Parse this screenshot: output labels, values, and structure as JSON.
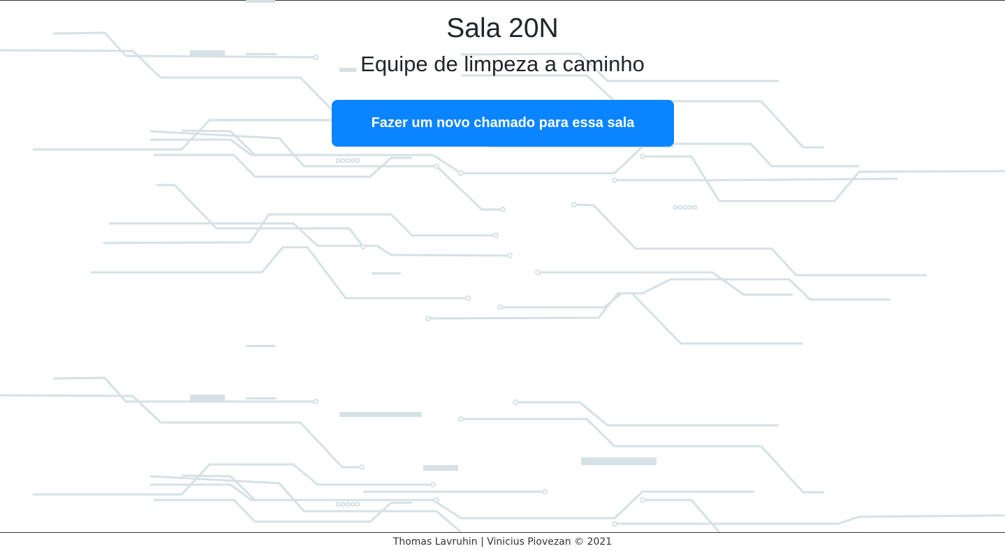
{
  "page": {
    "title": "Sala 20N",
    "status": "Equipe de limpeza a caminho",
    "new_call_button_label": "Fazer um novo chamado para essa sala"
  },
  "footer": {
    "credits": "Thomas Lavruhin | Vinicius Piovezan © 2021"
  },
  "colors": {
    "primary_button": "#0a84ff",
    "background_traces": "#d5e1e5",
    "text": "#212529"
  }
}
